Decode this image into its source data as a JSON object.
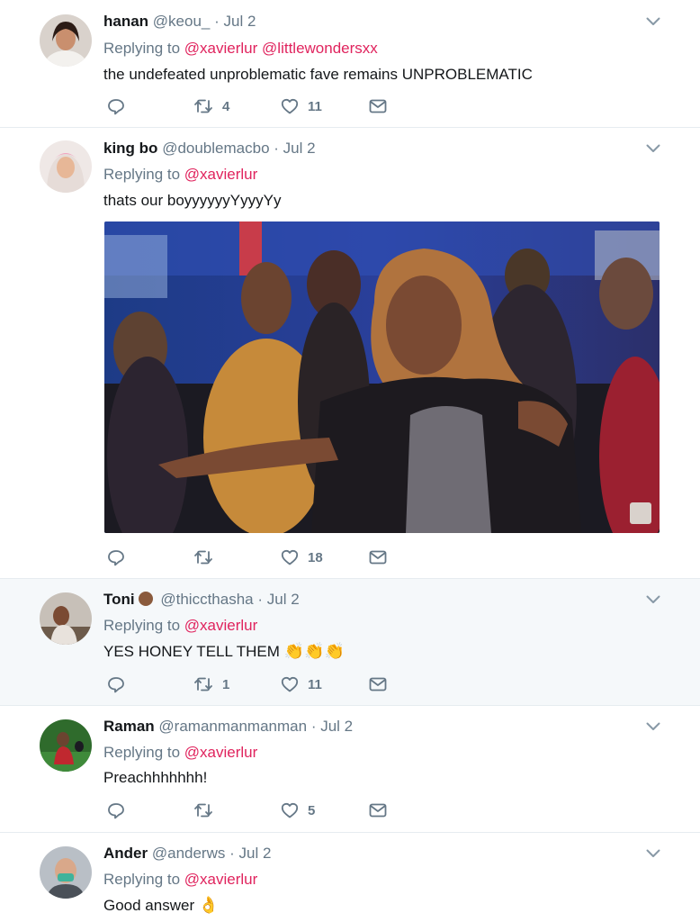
{
  "tweets": [
    {
      "name": "hanan",
      "handle": "@keou_",
      "sep": "·",
      "date": "Jul 2",
      "replying_prefix": "Replying to",
      "replying_to": [
        "@xavierlur",
        "@littlewondersxx"
      ],
      "text": "the undefeated unproblematic fave remains UNPROBLEMATIC",
      "retweets": "4",
      "likes": "11"
    },
    {
      "name": "king bo",
      "handle": "@doublemacbo",
      "sep": "·",
      "date": "Jul 2",
      "replying_prefix": "Replying to",
      "replying_to": [
        "@xavierlur"
      ],
      "text": "thats our boyyyyyyYyyyYy",
      "retweets": "",
      "likes": "18"
    },
    {
      "name": "Toni",
      "handle": "@thiccthasha",
      "sep": "·",
      "date": "Jul 2",
      "replying_prefix": "Replying to",
      "replying_to": [
        "@xavierlur"
      ],
      "text": "YES HONEY TELL THEM",
      "emoji": "👏👏👏",
      "retweets": "1",
      "likes": "11"
    },
    {
      "name": "Raman",
      "handle": "@ramanmanmanman",
      "sep": "·",
      "date": "Jul 2",
      "replying_prefix": "Replying to",
      "replying_to": [
        "@xavierlur"
      ],
      "text": "Preachhhhhhh!",
      "retweets": "",
      "likes": "5"
    },
    {
      "name": "Ander",
      "handle": "@anderws",
      "sep": "·",
      "date": "Jul 2",
      "replying_prefix": "Replying to",
      "replying_to": [
        "@xavierlur"
      ],
      "text": "Good answer",
      "emoji": "👌"
    }
  ],
  "colors": {
    "link": "#e0245e",
    "muted": "#657786",
    "divider": "#e6ecf0",
    "highlight_bg": "#f5f8fa"
  },
  "icons": [
    "reply-icon",
    "retweet-icon",
    "like-icon",
    "message-icon",
    "chevron-down-icon"
  ]
}
